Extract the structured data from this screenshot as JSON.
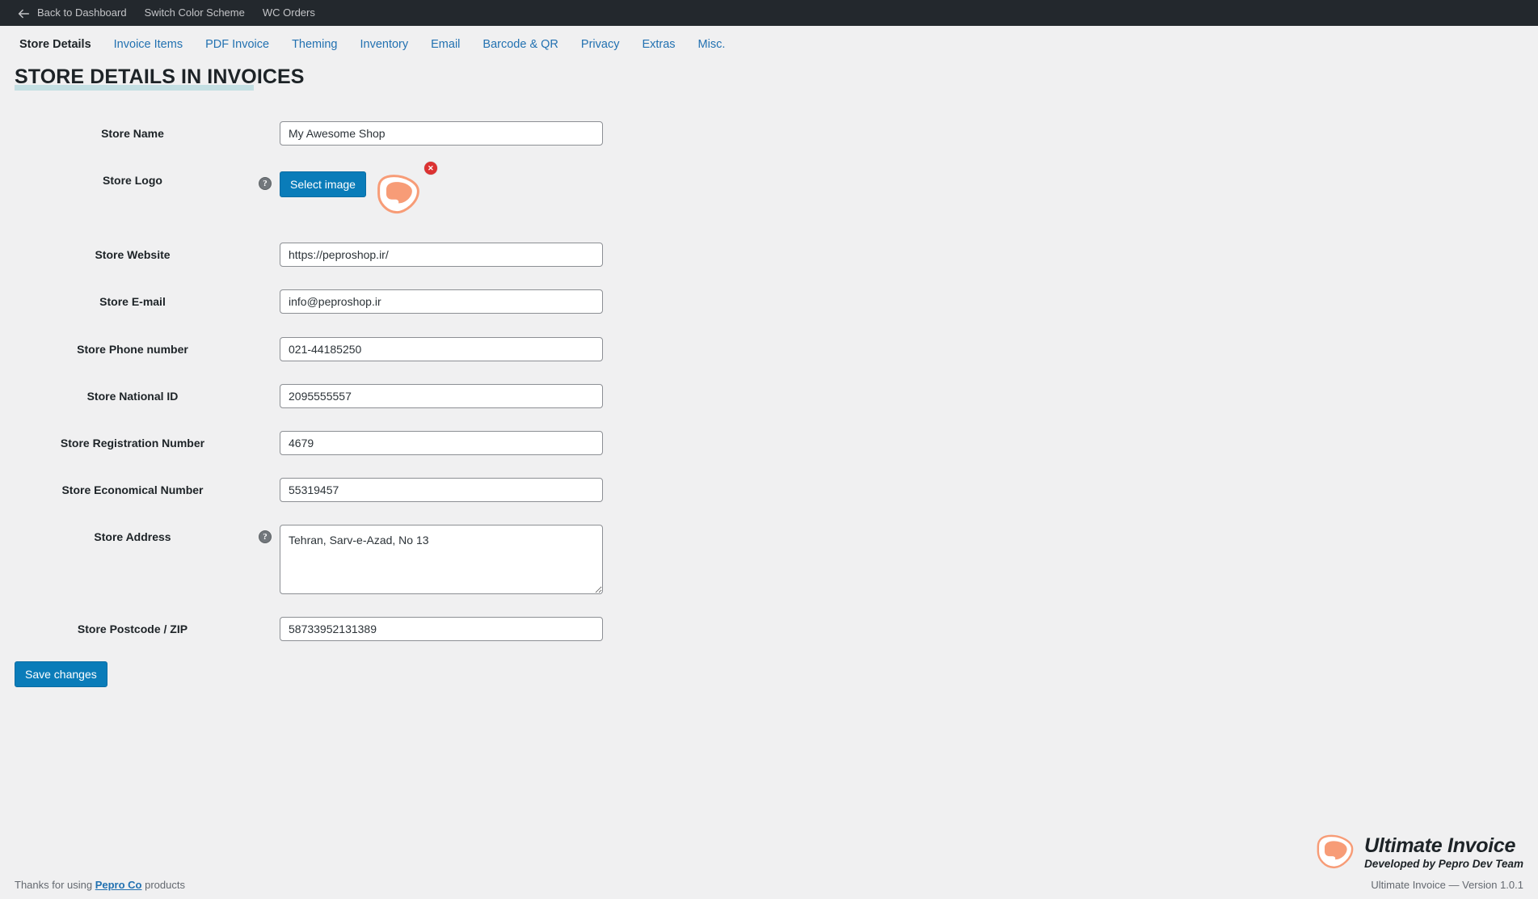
{
  "adminbar": {
    "back_label": "Back to Dashboard",
    "back_icon": "arrow-left-icon",
    "items": [
      {
        "label": "Switch Color Scheme"
      },
      {
        "label": "WC Orders"
      }
    ]
  },
  "tabs": [
    {
      "label": "Store Details",
      "active": true
    },
    {
      "label": "Invoice Items",
      "active": false
    },
    {
      "label": "PDF Invoice",
      "active": false
    },
    {
      "label": "Theming",
      "active": false
    },
    {
      "label": "Inventory",
      "active": false
    },
    {
      "label": "Email",
      "active": false
    },
    {
      "label": "Barcode & QR",
      "active": false
    },
    {
      "label": "Privacy",
      "active": false
    },
    {
      "label": "Extras",
      "active": false
    },
    {
      "label": "Misc.",
      "active": false
    }
  ],
  "heading": "STORE DETAILS IN INVOICES",
  "fields": {
    "store_name": {
      "label": "Store Name",
      "value": "My Awesome Shop",
      "placeholder": ""
    },
    "store_logo": {
      "label": "Store Logo",
      "help_icon": "question-mark-icon",
      "select_button": "Select image",
      "remove_icon": "close-icon",
      "preview_alt": "store-logo-preview"
    },
    "store_website": {
      "label": "Store Website",
      "value": "https://peproshop.ir/",
      "placeholder": ""
    },
    "store_email": {
      "label": "Store E-mail",
      "value": "info@peproshop.ir",
      "placeholder": ""
    },
    "store_phone": {
      "label": "Store Phone number",
      "value": "021-44185250",
      "placeholder": ""
    },
    "store_national_id": {
      "label": "Store National ID",
      "value": "2095555557",
      "placeholder": ""
    },
    "store_registration_number": {
      "label": "Store Registration Number",
      "value": "4679",
      "placeholder": ""
    },
    "store_economical_number": {
      "label": "Store Economical Number",
      "value": "55319457",
      "placeholder": ""
    },
    "store_address": {
      "label": "Store Address",
      "help_icon": "question-mark-icon",
      "value": "Tehran, Sarv-e-Azad, No 13",
      "placeholder": ""
    },
    "store_postcode": {
      "label": "Store Postcode / ZIP",
      "value": "58733952131389",
      "placeholder": ""
    }
  },
  "submit": {
    "label": "Save changes"
  },
  "footer": {
    "thanks_prefix": "Thanks for using ",
    "thanks_link": "Pepro Co",
    "thanks_suffix": " products",
    "brand_name": "Ultimate Invoice",
    "brand_sub": "Developed by Pepro Dev Team",
    "version_line": "Ultimate Invoice — Version 1.0.1"
  },
  "colors": {
    "adminbar_bg": "#23282d",
    "page_bg": "#f0f0f1",
    "link": "#2271b1",
    "button": "#0a7cb9",
    "heading_underline": "#bcdce0",
    "logo_orange": "#f79c77",
    "danger": "#dc3232"
  }
}
